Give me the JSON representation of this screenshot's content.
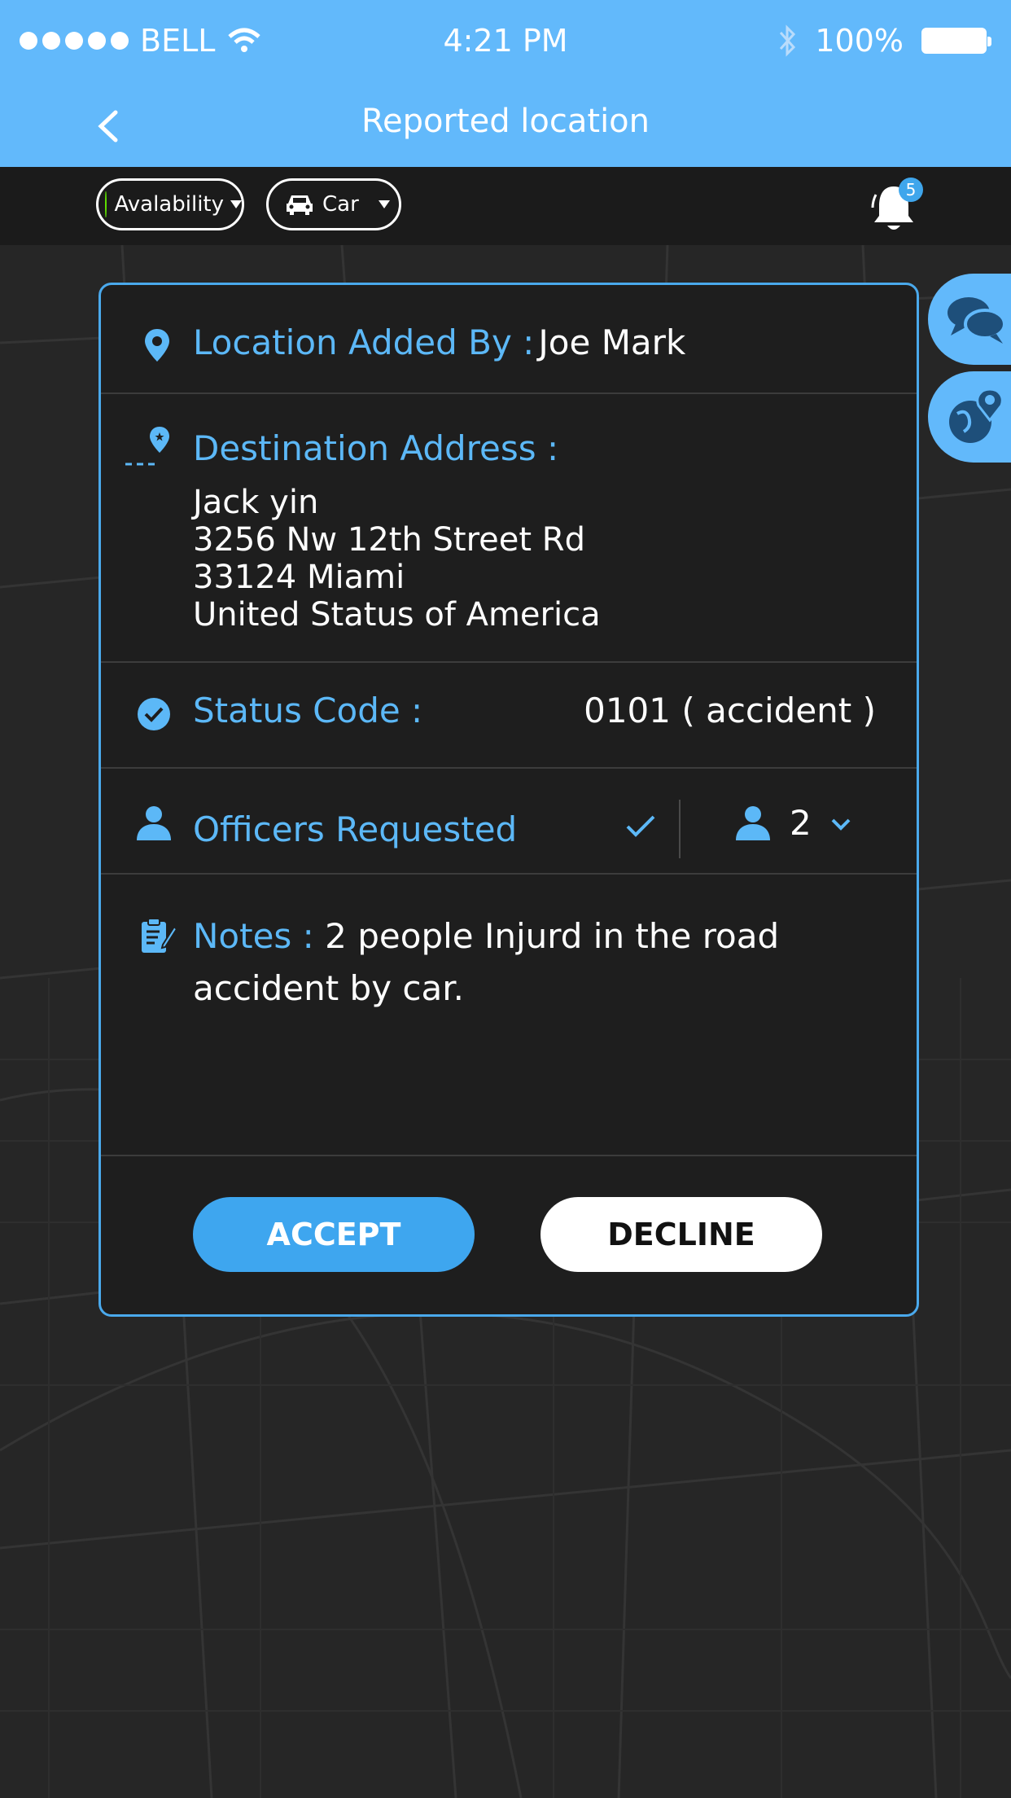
{
  "status_bar": {
    "carrier": "BELL",
    "time": "4:21 PM",
    "battery": "100%"
  },
  "nav": {
    "title": "Reported location"
  },
  "toolbar": {
    "availability_label": "Avalability",
    "vehicle_label": "Car",
    "notification_count": "5"
  },
  "card": {
    "added_by_label": "Location Added By :",
    "added_by_value": "Joe Mark",
    "destination_label": "Destination Address :",
    "address": {
      "name": "Jack yin",
      "street": "3256 Nw 12th Street Rd",
      "city": "33124 Miami",
      "country": "United Status of America"
    },
    "status_label": "Status Code :",
    "status_value": "0101  ( accident )",
    "officers_label": "Officers Requested",
    "officers_count": "2",
    "notes_label": "Notes :",
    "notes_value": "2 people Injurd in the road accident by car.",
    "accept_label": "ACCEPT",
    "decline_label": "DECLINE"
  },
  "colors": {
    "accent": "#62b9fb",
    "label_blue": "#5cb8f7",
    "available_green": "#5fe000",
    "card_bg": "#1e1e1e"
  }
}
